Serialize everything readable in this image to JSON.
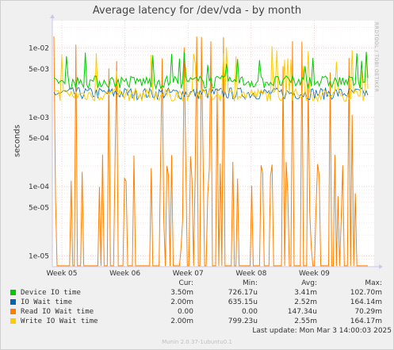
{
  "title": "Average latency for /dev/vda - by month",
  "side_label": "RRDTOOL / TOBI OETIKER",
  "chart_data": {
    "type": "line",
    "ylabel": "seconds",
    "yscale": "log",
    "ylim": [
      7e-06,
      0.025
    ],
    "yticks": [
      "1e-02",
      "5e-03",
      "1e-03",
      "5e-04",
      "1e-04",
      "5e-05",
      "1e-05"
    ],
    "xticks": [
      "Week 05",
      "Week 06",
      "Week 07",
      "Week 08",
      "Week 09"
    ],
    "series": [
      {
        "name": "Device IO time",
        "color": "#00cc00"
      },
      {
        "name": "IO Wait time",
        "color": "#0066b3"
      },
      {
        "name": "Read IO Wait time",
        "color": "#ff8000"
      },
      {
        "name": "Write IO Wait time",
        "color": "#ffcc00"
      }
    ]
  },
  "legend": {
    "headers": [
      "Cur:",
      "Min:",
      "Avg:",
      "Max:"
    ],
    "rows": [
      {
        "name": "Device IO time",
        "color": "#00cc00",
        "cur": "3.50m",
        "min": "726.17u",
        "avg": "3.41m",
        "max": "102.70m"
      },
      {
        "name": "IO Wait time",
        "color": "#0066b3",
        "cur": "2.00m",
        "min": "635.15u",
        "avg": "2.52m",
        "max": "164.14m"
      },
      {
        "name": "Read IO Wait time",
        "color": "#ff8000",
        "cur": "0.00",
        "min": "0.00",
        "avg": "147.34u",
        "max": "70.29m"
      },
      {
        "name": "Write IO Wait time",
        "color": "#ffcc00",
        "cur": "2.00m",
        "min": "799.23u",
        "avg": "2.55m",
        "max": "164.17m"
      }
    ]
  },
  "last_update": "Last update: Mon Mar  3 14:00:03 2025",
  "footer": "Munin 2.0.37-1ubuntu0.1"
}
